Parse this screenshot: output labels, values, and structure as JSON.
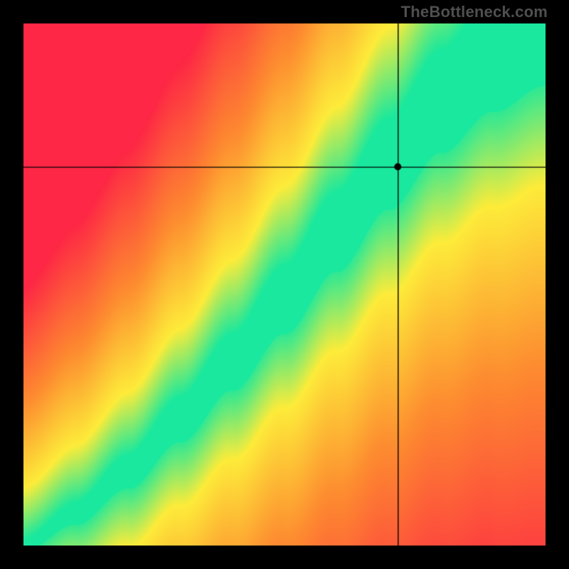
{
  "watermark": "TheBottleneck.com",
  "canvas": {
    "inner_size": 734,
    "offset_x": 33,
    "offset_y": 33
  },
  "marker": {
    "x_frac": 0.718,
    "y_frac": 0.275,
    "radius": 5
  },
  "colors": {
    "red": "#fe2745",
    "orange": "#fd8b30",
    "yellow": "#fdec3a",
    "green": "#19e89e",
    "crosshair": "#000000",
    "frame": "#000000"
  },
  "chart_data": {
    "type": "heatmap",
    "title": "",
    "xlabel": "",
    "ylabel": "",
    "x_range": [
      0,
      1
    ],
    "y_range": [
      0,
      1
    ],
    "description": "Smooth 2D goodness field: distance from a superlinear ridge y = f(x). Green on the ridge, fading through yellow and orange to red away from it.",
    "ridge": {
      "form": "piecewise-power",
      "points_xy": [
        [
          0.0,
          0.0
        ],
        [
          0.1,
          0.06
        ],
        [
          0.2,
          0.14
        ],
        [
          0.3,
          0.24
        ],
        [
          0.4,
          0.35
        ],
        [
          0.5,
          0.47
        ],
        [
          0.6,
          0.6
        ],
        [
          0.7,
          0.73
        ],
        [
          0.8,
          0.85
        ],
        [
          0.9,
          0.94
        ],
        [
          1.0,
          1.0
        ]
      ]
    },
    "band_half_width": {
      "at_x0": 0.01,
      "at_x1": 0.12,
      "growth": "linear"
    },
    "marker_point": {
      "x": 0.718,
      "y": 0.725
    },
    "legend": null,
    "grid": false
  }
}
